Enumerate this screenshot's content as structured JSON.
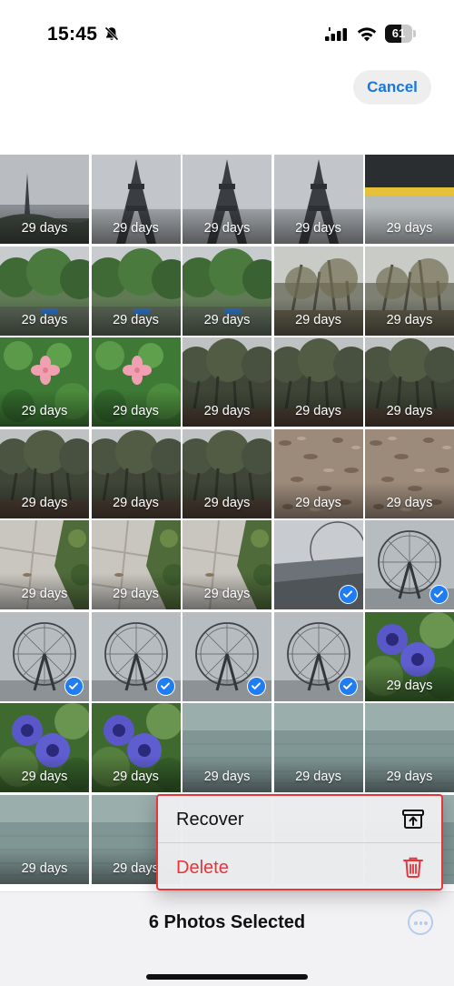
{
  "status_bar": {
    "time": "15:45",
    "battery": "61",
    "battery_level": 0.61,
    "icons": [
      "bell-slash-icon",
      "signal-icon",
      "wifi-icon",
      "battery-icon"
    ]
  },
  "header": {
    "cancel_label": "Cancel"
  },
  "grid": {
    "columns": 5,
    "tiles": [
      {
        "label": "29 days",
        "scene": "tower-small",
        "selected": false
      },
      {
        "label": "29 days",
        "scene": "tower",
        "selected": false
      },
      {
        "label": "29 days",
        "scene": "tower",
        "selected": false
      },
      {
        "label": "29 days",
        "scene": "tower",
        "selected": false
      },
      {
        "label": "29 days",
        "scene": "train-platform",
        "selected": false
      },
      {
        "label": "29 days",
        "scene": "park-trees",
        "selected": false
      },
      {
        "label": "29 days",
        "scene": "park-trees",
        "selected": false
      },
      {
        "label": "29 days",
        "scene": "park-trees",
        "selected": false
      },
      {
        "label": "29 days",
        "scene": "bare-trees",
        "selected": false
      },
      {
        "label": "29 days",
        "scene": "bare-trees",
        "selected": false
      },
      {
        "label": "29 days",
        "scene": "pink-flower",
        "selected": false
      },
      {
        "label": "29 days",
        "scene": "pink-flower",
        "selected": false
      },
      {
        "label": "29 days",
        "scene": "dark-forest",
        "selected": false
      },
      {
        "label": "29 days",
        "scene": "dark-forest",
        "selected": false
      },
      {
        "label": "29 days",
        "scene": "dark-forest",
        "selected": false
      },
      {
        "label": "29 days",
        "scene": "dark-forest",
        "selected": false
      },
      {
        "label": "29 days",
        "scene": "dark-forest",
        "selected": false
      },
      {
        "label": "29 days",
        "scene": "dark-forest",
        "selected": false
      },
      {
        "label": "29 days",
        "scene": "leaf-ground",
        "selected": false
      },
      {
        "label": "29 days",
        "scene": "leaf-ground",
        "selected": false
      },
      {
        "label": "29 days",
        "scene": "pavement",
        "selected": false
      },
      {
        "label": "29 days",
        "scene": "pavement",
        "selected": false
      },
      {
        "label": "29 days",
        "scene": "pavement",
        "selected": false
      },
      {
        "label": "",
        "scene": "ferris-bridge",
        "selected": true
      },
      {
        "label": "",
        "scene": "ferris-wheel",
        "selected": true
      },
      {
        "label": "",
        "scene": "ferris-wheel",
        "selected": true
      },
      {
        "label": "",
        "scene": "ferris-wheel",
        "selected": true
      },
      {
        "label": "",
        "scene": "ferris-wheel",
        "selected": true
      },
      {
        "label": "",
        "scene": "ferris-wheel",
        "selected": true
      },
      {
        "label": "29 days",
        "scene": "purple-flowers",
        "selected": false
      },
      {
        "label": "29 days",
        "scene": "purple-flowers",
        "selected": false
      },
      {
        "label": "29 days",
        "scene": "purple-flowers",
        "selected": false
      },
      {
        "label": "29 days",
        "scene": "water",
        "selected": false
      },
      {
        "label": "29 days",
        "scene": "water",
        "selected": false
      },
      {
        "label": "29 days",
        "scene": "water",
        "selected": false
      },
      {
        "label": "29 days",
        "scene": "water",
        "selected": false
      },
      {
        "label": "29 days",
        "scene": "water",
        "selected": false
      },
      {
        "label": "",
        "scene": "water",
        "selected": false
      },
      {
        "label": "",
        "scene": "water",
        "selected": false
      },
      {
        "label": "",
        "scene": "water",
        "selected": false
      }
    ]
  },
  "context_menu": {
    "items": [
      {
        "label": "Recover",
        "icon": "archive-restore-icon",
        "color": "#111111"
      },
      {
        "label": "Delete",
        "icon": "trash-icon",
        "color": "#e8343b"
      }
    ]
  },
  "bottom_bar": {
    "selection_count": "6 Photos Selected",
    "more_icon": "ellipsis-circle-icon"
  },
  "colors": {
    "accent": "#1677e5",
    "destructive": "#e8343b",
    "check": "#1f7cf2"
  }
}
